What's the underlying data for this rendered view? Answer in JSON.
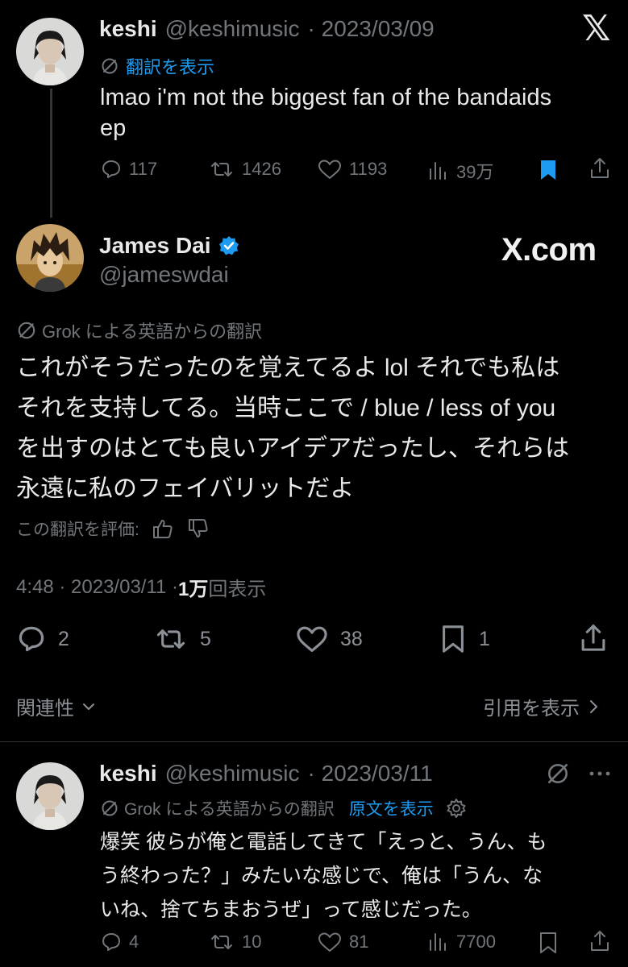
{
  "tweet1": {
    "name": "keshi",
    "handle": "@keshimusic",
    "date": "· 2023/03/09",
    "translate_label": "翻訳を表示",
    "text_line1": "lmao i'm not the biggest fan of the bandaids",
    "text_line2": "ep",
    "replies": "117",
    "retweets": "1426",
    "likes": "1193",
    "views": "39万",
    "bookmark_color": "#1d9bf0"
  },
  "x_logo": "𝕏",
  "tweet2": {
    "name": "James Dai",
    "handle": "@jameswdai",
    "watermark": "X.com",
    "grok_label": "Grok による英語からの翻訳",
    "text_lines": [
      "これがそうだったのを覚えてるよ lol それでも私は",
      "それを支持してる。当時ここで / blue / less of you",
      "を出すのはとても良いアイデアだったし、それらは",
      "永遠に私のフェイバリットだよ"
    ],
    "rate_label": "この翻訳を評価:",
    "time": "4:48 · 2023/03/11 · ",
    "views_count": "1万",
    "views_label": "回表示",
    "replies": "2",
    "retweets": "5",
    "likes": "38",
    "bookmarks": "1",
    "relevance_label": "関連性",
    "quotes_label": "引用を表示"
  },
  "tweet3": {
    "name": "keshi",
    "handle": "@keshimusic",
    "date": "· 2023/03/11",
    "grok_label": "Grok による英語からの翻訳",
    "original_label": "原文を表示",
    "text_lines": [
      "爆笑 彼らが俺と電話してきて「えっと、うん、も",
      "う終わった？」みたいな感じで、俺は「うん、な",
      "いね、捨てちまおうぜ」って感じだった。"
    ],
    "replies": "4",
    "retweets": "10",
    "likes": "81",
    "views": "7700"
  },
  "colors": {
    "accent": "#1d9bf0",
    "verified": "#1d9bf0",
    "background": "#000000"
  }
}
